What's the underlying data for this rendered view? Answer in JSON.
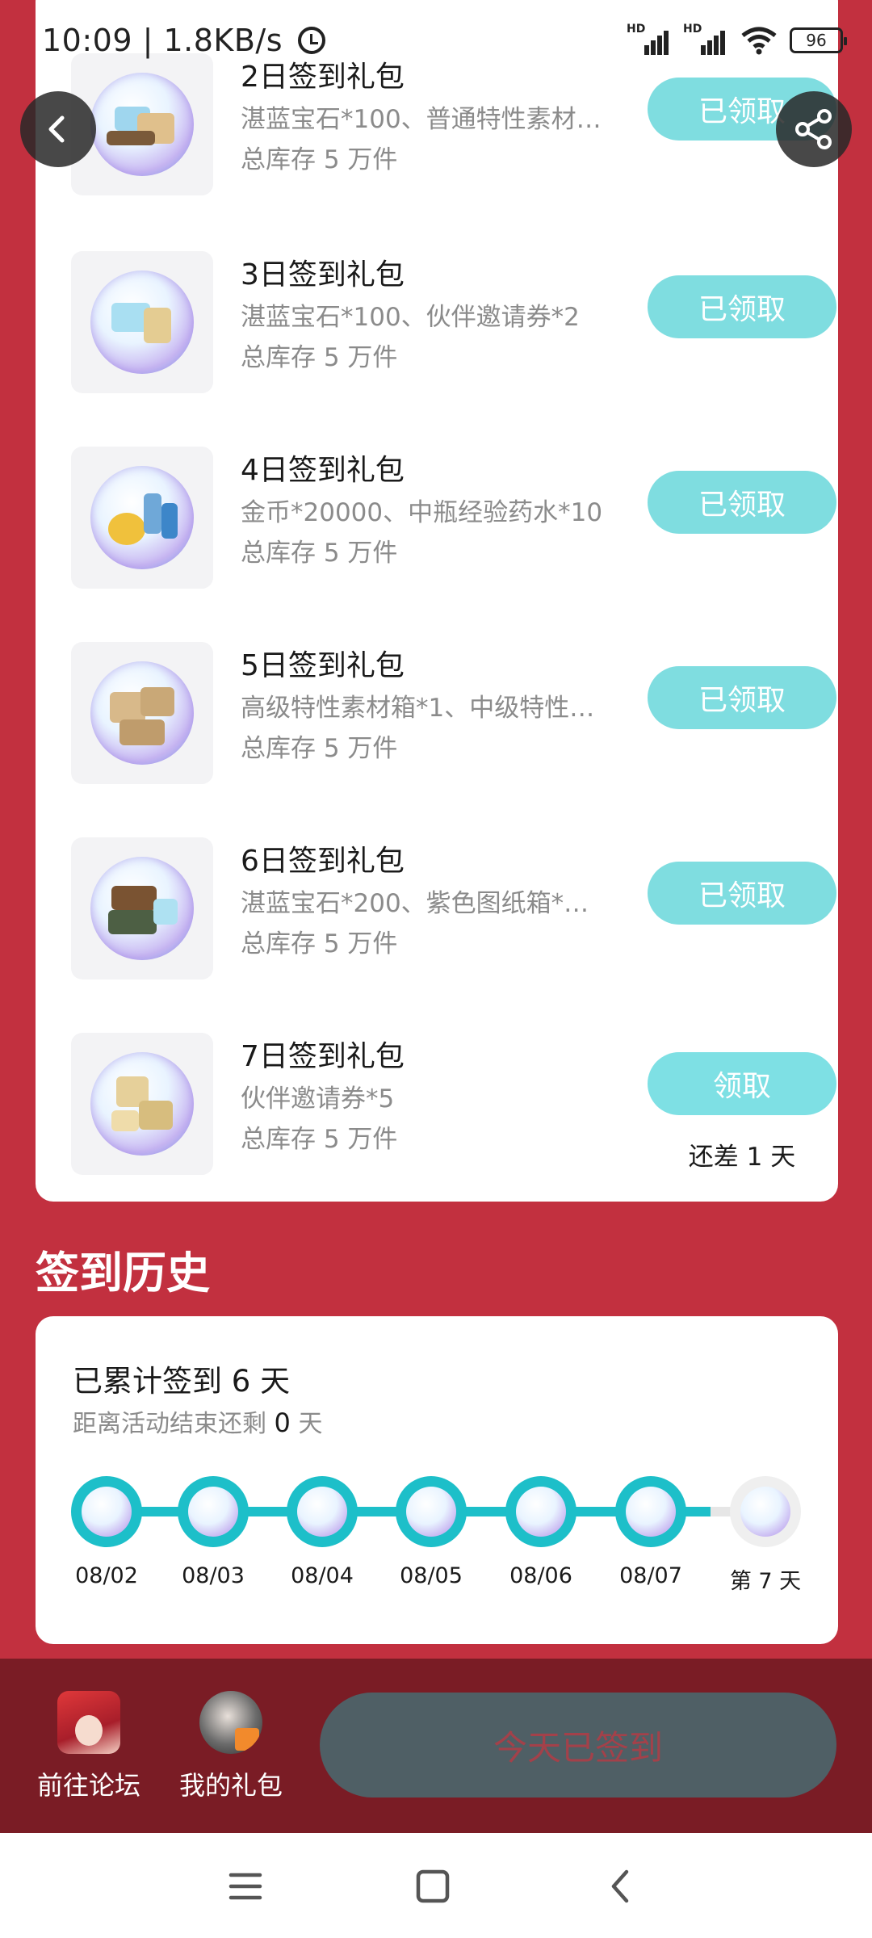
{
  "status": {
    "time_speed": "10:09 | 1.8KB/s",
    "battery": "96",
    "hd1": "HD",
    "hd2": "HD"
  },
  "gifts": [
    {
      "name": "2日签到礼包",
      "desc": "湛蓝宝石*100、普通特性素材…",
      "stock": "总库存 5 万件",
      "button": "已领取"
    },
    {
      "name": "3日签到礼包",
      "desc": "湛蓝宝石*100、伙伴邀请券*2",
      "stock": "总库存 5 万件",
      "button": "已领取"
    },
    {
      "name": "4日签到礼包",
      "desc": "金币*20000、中瓶经验药水*10",
      "stock": "总库存 5 万件",
      "button": "已领取"
    },
    {
      "name": "5日签到礼包",
      "desc": "高级特性素材箱*1、中级特性…",
      "stock": "总库存 5 万件",
      "button": "已领取"
    },
    {
      "name": "6日签到礼包",
      "desc": "湛蓝宝石*200、紫色图纸箱*…",
      "stock": "总库存 5 万件",
      "button": "已领取"
    },
    {
      "name": "7日签到礼包",
      "desc": "伙伴邀请券*5",
      "stock": "总库存 5 万件",
      "button": "领取",
      "note": "还差 1 天"
    }
  ],
  "history": {
    "title": "签到历史",
    "total_prefix": "已累计签到",
    "total_days": "6",
    "total_suffix": "天",
    "remain_prefix": "距离活动结束还剩",
    "remain_days": "0",
    "remain_suffix": "天",
    "days": [
      "08/02",
      "08/03",
      "08/04",
      "08/05",
      "08/06",
      "08/07",
      "第 7 天"
    ]
  },
  "bottom": {
    "forum": "前往论坛",
    "my_gifts": "我的礼包",
    "signed": "今天已签到"
  },
  "colors": {
    "page_bg": "#c2303f",
    "accent_teal": "#1dbfc9",
    "claim_button": "#7fdde0",
    "bottom_bar": "#7a1c25"
  }
}
